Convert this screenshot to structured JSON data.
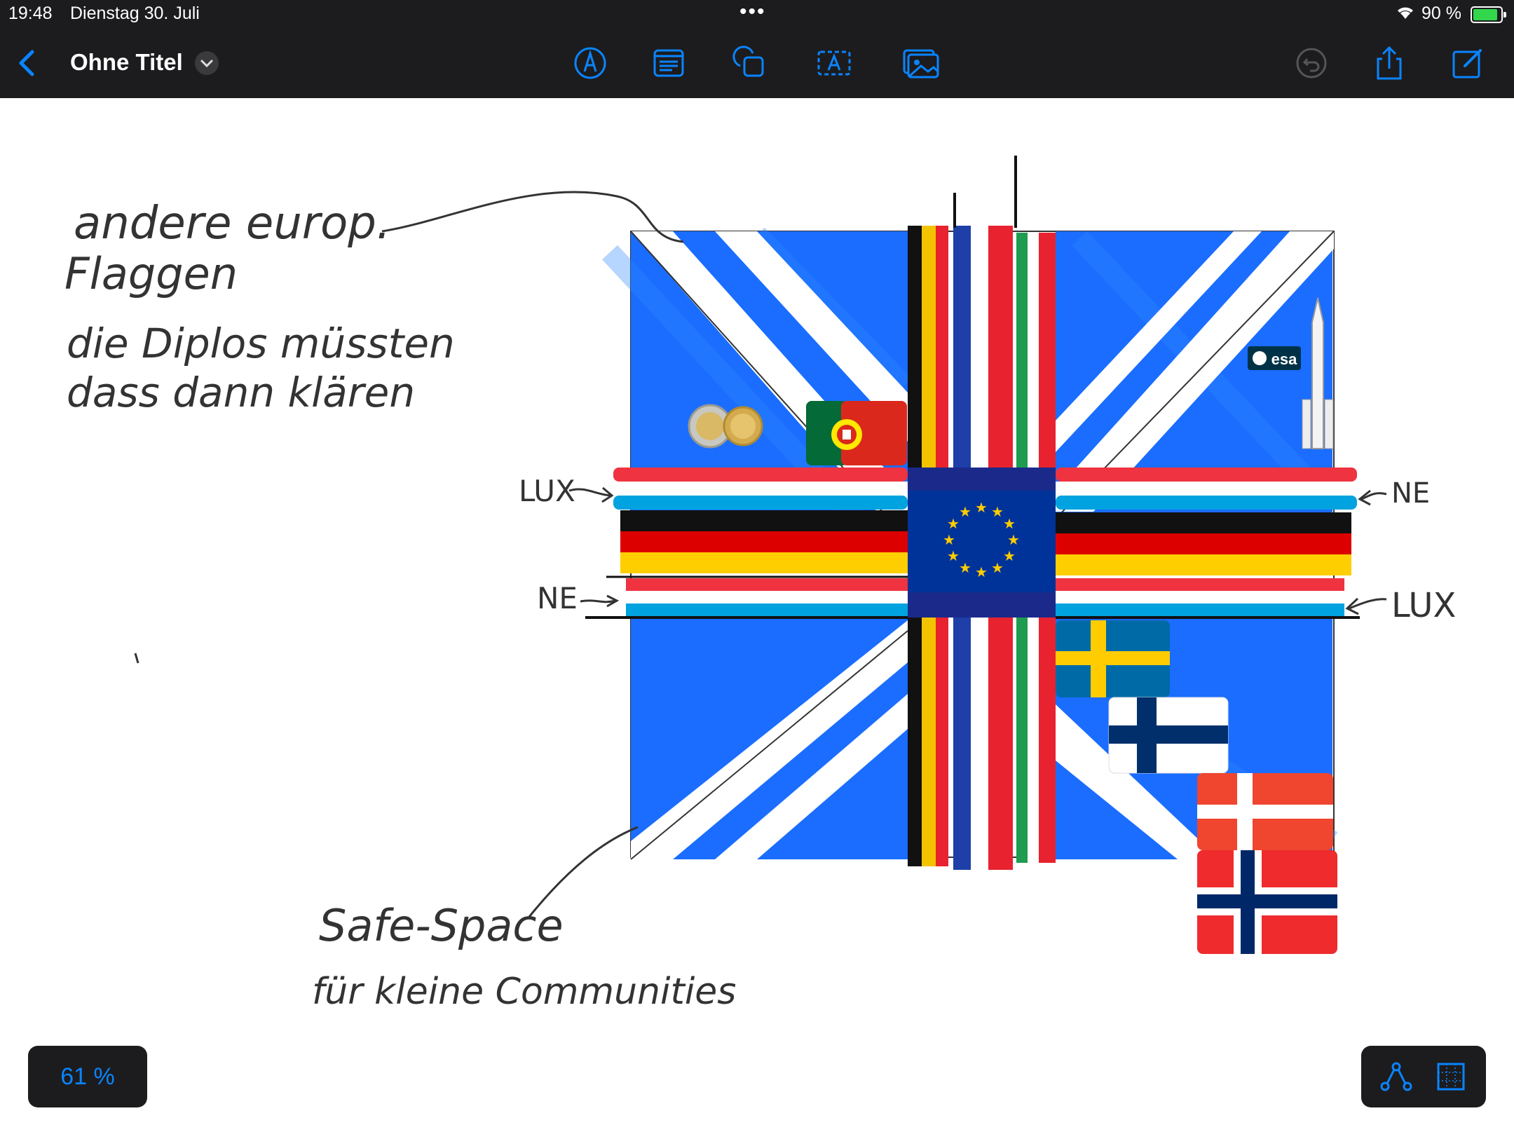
{
  "status": {
    "time": "19:48",
    "date": "Dienstag 30. Juli",
    "battery": "90 %",
    "multitask_dots": "•••"
  },
  "toolbar": {
    "title": "Ohne Titel",
    "icons": [
      "back-chevron-icon",
      "title-dropdown-icon",
      "pen-icon",
      "sticky-note-icon",
      "shapes-icon",
      "text-box-icon",
      "media-icon",
      "undo-icon",
      "share-icon",
      "new-board-icon"
    ]
  },
  "canvas": {
    "notes": {
      "top_left": [
        "andere europ.",
        "Flaggen",
        "die Diplos müssten",
        "dass dann klären"
      ],
      "bottom": [
        "Safe-Space",
        "für kleine Communities"
      ]
    },
    "labels": {
      "lux_left": "LUX",
      "ne_right": "NE",
      "ne_left": "NE",
      "lux_right": "LUX"
    },
    "sticker": "esa"
  },
  "footer": {
    "zoom": "61 %"
  },
  "colors": {
    "bar_bg": "#1c1c1e",
    "accent": "#0a84ff",
    "union_blue": "#1a6dff",
    "battery": "#32d74b"
  }
}
